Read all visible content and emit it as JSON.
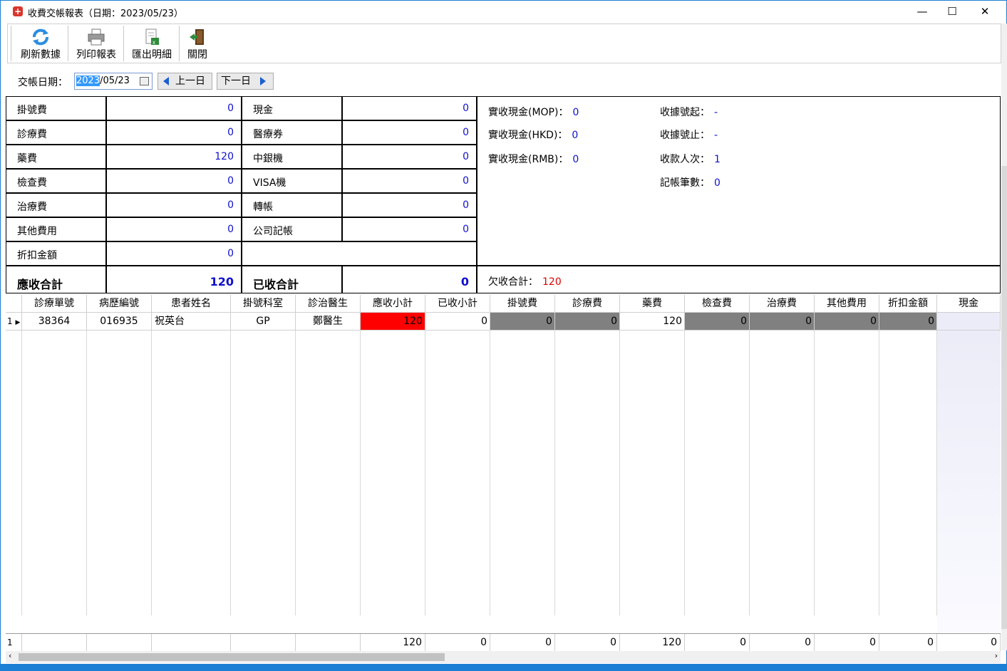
{
  "window": {
    "title": "收費交帳報表（日期：2023/05/23）",
    "minimize": "—",
    "maximize": "☐",
    "close": "✕"
  },
  "toolbar": {
    "refresh": "刷新數據",
    "print": "列印報表",
    "export": "匯出明細",
    "close": "關閉"
  },
  "datebar": {
    "label": "交帳日期：",
    "date_selected": "2023",
    "date_rest": "/05/23",
    "prev": "上一日",
    "next": "下一日"
  },
  "summary": {
    "left": [
      {
        "label": "掛號費",
        "value": "0"
      },
      {
        "label": "診療費",
        "value": "0"
      },
      {
        "label": "藥費",
        "value": "120"
      },
      {
        "label": "檢查費",
        "value": "0"
      },
      {
        "label": "治療費",
        "value": "0"
      },
      {
        "label": "其他費用",
        "value": "0"
      },
      {
        "label": "折扣金額",
        "value": "0"
      }
    ],
    "middle": [
      {
        "label": "現金",
        "value": "0"
      },
      {
        "label": "醫療券",
        "value": "0"
      },
      {
        "label": "中銀機",
        "value": "0"
      },
      {
        "label": "VISA機",
        "value": "0"
      },
      {
        "label": "轉帳",
        "value": "0"
      },
      {
        "label": "公司記帳",
        "value": "0"
      }
    ],
    "receivable_total_label": "應收合計",
    "receivable_total": "120",
    "received_total_label": "已收合計",
    "received_total": "0",
    "info": {
      "cash_mop_label": "實收現金(MOP)：",
      "cash_mop": "0",
      "cash_hkd_label": "實收現金(HKD)：",
      "cash_hkd": "0",
      "cash_rmb_label": "實收現金(RMB)：",
      "cash_rmb": "0",
      "receipt_start_label": "收據號起：",
      "receipt_start": "-",
      "receipt_end_label": "收據號止：",
      "receipt_end": "-",
      "payer_count_label": "收款人次：",
      "payer_count": "1",
      "ledger_count_label": "記帳筆數：",
      "ledger_count": "0",
      "owed_total_label": "欠收合計：",
      "owed_total": "120"
    }
  },
  "table": {
    "headers": [
      "診療單號",
      "病歷編號",
      "患者姓名",
      "掛號科室",
      "診治醫生",
      "應收小計",
      "已收小計",
      "掛號費",
      "診療費",
      "藥費",
      "檢查費",
      "治療費",
      "其他費用",
      "折扣金額",
      "現金"
    ],
    "rows": [
      {
        "index": "1",
        "cells": [
          "38364",
          "016935",
          "祝英台",
          "GP",
          "鄭醫生",
          "120",
          "0",
          "0",
          "0",
          "120",
          "0",
          "0",
          "0",
          "0",
          ""
        ]
      }
    ],
    "footer": {
      "index": "1",
      "cells": [
        "",
        "",
        "",
        "",
        "",
        "120",
        "0",
        "0",
        "0",
        "120",
        "0",
        "0",
        "0",
        "0",
        "0"
      ]
    }
  },
  "colors": {
    "accent_blue": "#1010d0",
    "warn_red": "#ff0000",
    "gray_cell": "#808080"
  }
}
